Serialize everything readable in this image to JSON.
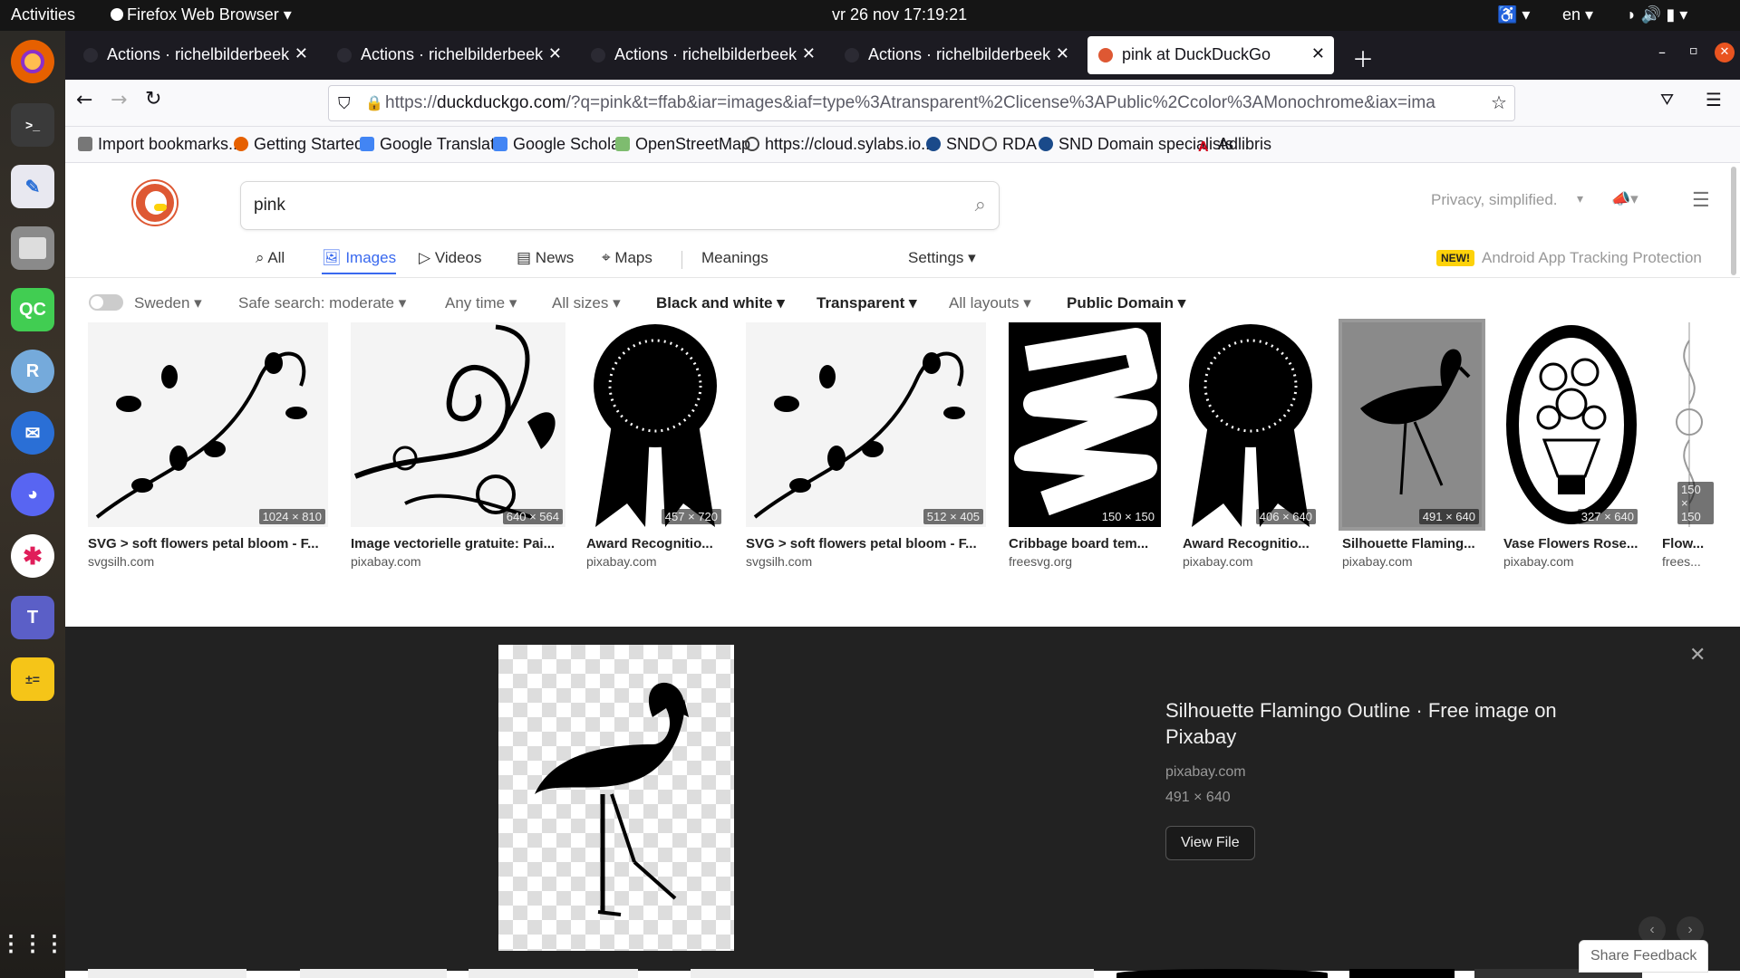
{
  "topbar": {
    "activities": "Activities",
    "app": "Firefox Web Browser",
    "datetime": "vr 26 nov  17:19:21",
    "lang": "en"
  },
  "dock": {
    "items": [
      {
        "name": "firefox-icon",
        "color": "#e66000"
      },
      {
        "name": "terminal-icon",
        "color": "#3a3a3a"
      },
      {
        "name": "text-editor-icon",
        "color": "#e8e8f0"
      },
      {
        "name": "files-icon",
        "color": "#8a8a8a"
      },
      {
        "name": "qtcreator-icon",
        "label": "QC",
        "color": "#41cd52"
      },
      {
        "name": "rstudio-icon",
        "label": "R",
        "color": "#75aadb"
      },
      {
        "name": "thunderbird-icon",
        "color": "#2a6fd6"
      },
      {
        "name": "discord-icon",
        "color": "#5865f2"
      },
      {
        "name": "slack-icon",
        "color": "#ffffff"
      },
      {
        "name": "teams-icon",
        "label": "T",
        "color": "#5b5fc7"
      },
      {
        "name": "calculator-icon",
        "color": "#f5c518"
      }
    ]
  },
  "tabs": [
    {
      "title": "Actions · richelbilderbeek",
      "active": false
    },
    {
      "title": "Actions · richelbilderbeek",
      "active": false
    },
    {
      "title": "Actions · richelbilderbeek",
      "active": false
    },
    {
      "title": "Actions · richelbilderbeek",
      "active": false
    },
    {
      "title": "pink at DuckDuckGo",
      "active": true
    }
  ],
  "nav": {
    "url_prefix": "https://",
    "url_domain": "duckduckgo.com",
    "url_rest": "/?q=pink&t=ffab&iar=images&iaf=type%3Atransparent%2Clicense%3APublic%2Ccolor%3AMonochrome&iax=ima"
  },
  "bookmarks": [
    {
      "label": "Import bookmarks...",
      "color": "#555"
    },
    {
      "label": "Getting Started",
      "color": "#e66000"
    },
    {
      "label": "Google Translate",
      "color": "#4285f4"
    },
    {
      "label": "Google Scholar",
      "color": "#4285f4"
    },
    {
      "label": "OpenStreetMap",
      "color": "#7ebc6f"
    },
    {
      "label": "https://cloud.sylabs.io...",
      "color": "#444"
    },
    {
      "label": "SND",
      "color": "#1a4a8a"
    },
    {
      "label": "RDA",
      "color": "#444"
    },
    {
      "label": "SND Domain specialists",
      "color": "#1a4a8a"
    },
    {
      "label": "Adlibris",
      "color": "#d0021b"
    }
  ],
  "ddg": {
    "query": "pink",
    "tagline": "Privacy, simplified.",
    "tabs": [
      "All",
      "Images",
      "Videos",
      "News",
      "Maps",
      "Meanings",
      "Settings"
    ],
    "new_badge": "NEW!",
    "promo": "Android App Tracking Protection",
    "filters": [
      "Sweden",
      "Safe search: moderate",
      "Any time",
      "All sizes",
      "Black and white",
      "Transparent",
      "All layouts",
      "Public Domain"
    ],
    "images": [
      {
        "dims": "1024 × 810",
        "title": "SVG > soft flowers petal bloom - F...",
        "source": "svgsilh.com"
      },
      {
        "dims": "640 × 564",
        "title": "Image vectorielle gratuite: Pai...",
        "source": "pixabay.com"
      },
      {
        "dims": "457 × 720",
        "title": "Award Recognitio...",
        "source": "pixabay.com"
      },
      {
        "dims": "512 × 405",
        "title": "SVG > soft flowers petal bloom - F...",
        "source": "svgsilh.com"
      },
      {
        "dims": "150 × 150",
        "title": "Cribbage board tem...",
        "source": "freesvg.org"
      },
      {
        "dims": "406 × 640",
        "title": "Award Recognitio...",
        "source": "pixabay.com"
      },
      {
        "dims": "491 × 640",
        "title": "Silhouette Flaming...",
        "source": "pixabay.com"
      },
      {
        "dims": "327 × 640",
        "title": "Vase Flowers Rose...",
        "source": "pixabay.com"
      },
      {
        "dims": "150 × 150",
        "title": "Flow...",
        "source": "frees..."
      }
    ],
    "detail": {
      "title": "Silhouette Flamingo Outline · Free image on Pixabay",
      "source": "pixabay.com",
      "dims": "491 × 640",
      "button": "View File"
    },
    "feedback": "Share Feedback"
  }
}
